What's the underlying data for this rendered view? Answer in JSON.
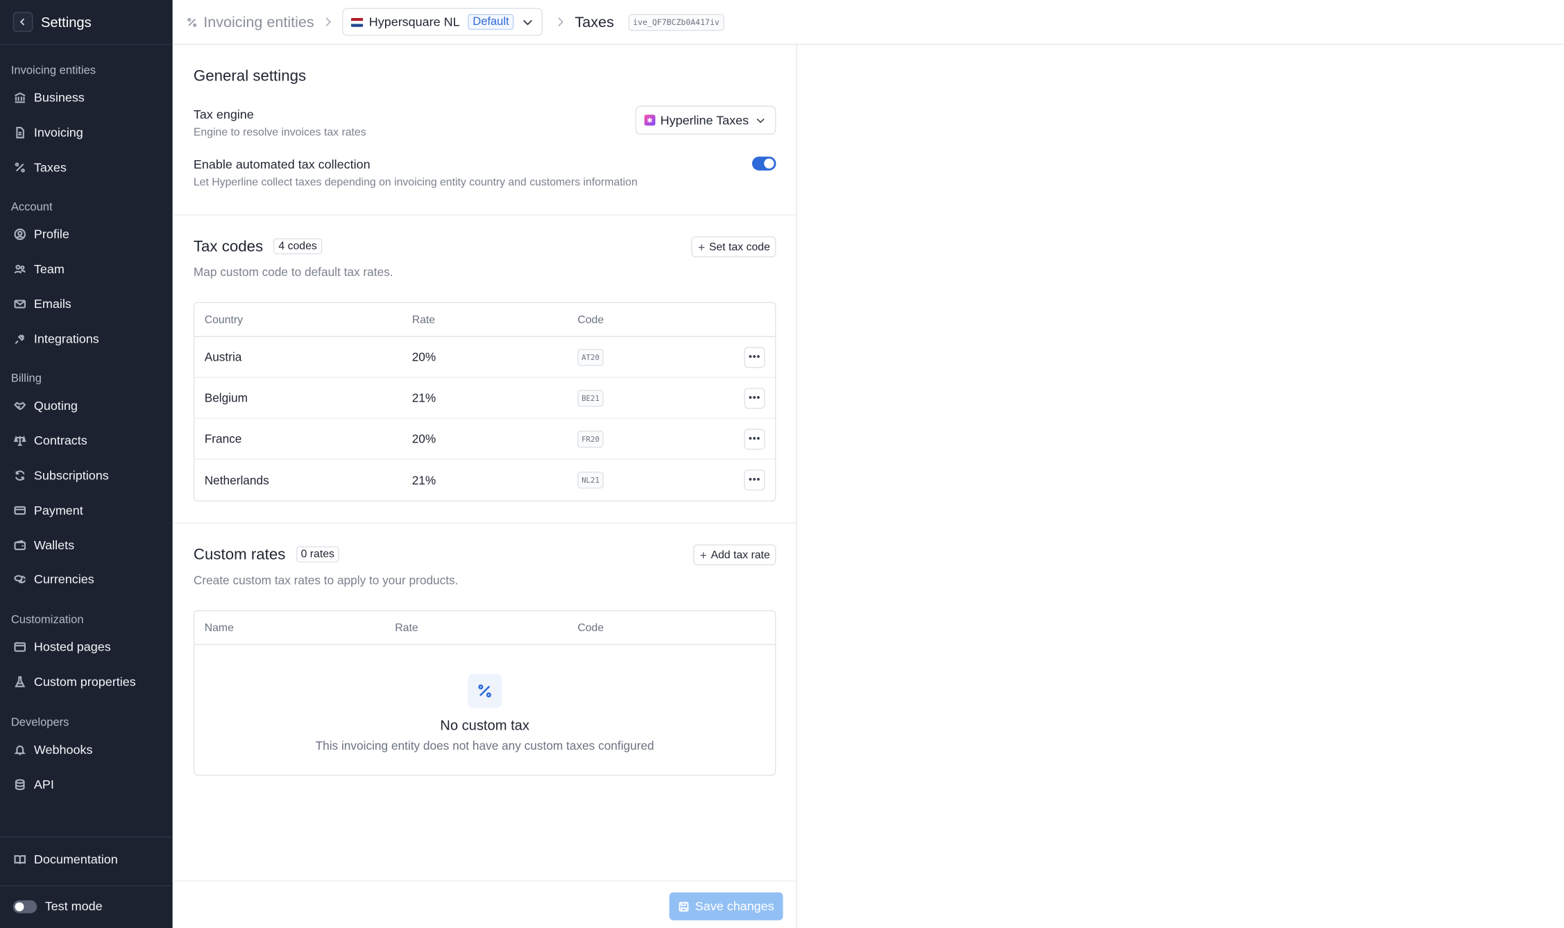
{
  "sidebar": {
    "title": "Settings",
    "sections": {
      "invoicing": "Invoicing entities",
      "account": "Account",
      "billing": "Billing",
      "customization": "Customization",
      "developers": "Developers"
    },
    "items": {
      "business": "Business",
      "invoicing": "Invoicing",
      "taxes": "Taxes",
      "profile": "Profile",
      "team": "Team",
      "emails": "Emails",
      "integrations": "Integrations",
      "quoting": "Quoting",
      "contracts": "Contracts",
      "subscriptions": "Subscriptions",
      "payment": "Payment",
      "wallets": "Wallets",
      "currencies": "Currencies",
      "hosted_pages": "Hosted pages",
      "custom_properties": "Custom properties",
      "webhooks": "Webhooks",
      "api": "API"
    },
    "documentation": "Documentation",
    "test_mode": "Test mode"
  },
  "topbar": {
    "crumb_root": "Invoicing entities",
    "entity_name": "Hypersquare NL",
    "entity_badge": "Default",
    "page_title": "Taxes",
    "entity_id": "ive_QF7BCZb0A417iv"
  },
  "general": {
    "title": "General settings",
    "engine_label": "Tax engine",
    "engine_desc": "Engine to resolve invoices tax rates",
    "engine_value": "Hyperline Taxes",
    "auto_label": "Enable automated tax collection",
    "auto_desc": "Let Hyperline collect taxes depending on invoicing entity country and customers information",
    "auto_enabled": true
  },
  "tax_codes": {
    "title": "Tax codes",
    "count": "4 codes",
    "desc": "Map custom code to default tax rates.",
    "button": "Set tax code",
    "columns": {
      "country": "Country",
      "rate": "Rate",
      "code": "Code"
    },
    "rows": [
      {
        "country": "Austria",
        "rate": "20%",
        "code": "AT20"
      },
      {
        "country": "Belgium",
        "rate": "21%",
        "code": "BE21"
      },
      {
        "country": "France",
        "rate": "20%",
        "code": "FR20"
      },
      {
        "country": "Netherlands",
        "rate": "21%",
        "code": "NL21"
      }
    ]
  },
  "custom_rates": {
    "title": "Custom rates",
    "count": "0 rates",
    "desc": "Create custom tax rates to apply to your products.",
    "button": "Add tax rate",
    "columns": {
      "name": "Name",
      "rate": "Rate",
      "code": "Code"
    },
    "empty_title": "No custom tax",
    "empty_desc": "This invoicing entity does not have any custom taxes configured"
  },
  "footer": {
    "save": "Save changes"
  },
  "colors": {
    "accent": "#2f6bd8",
    "sidebar_bg": "#1c2230",
    "save_disabled": "#93c0f4"
  }
}
